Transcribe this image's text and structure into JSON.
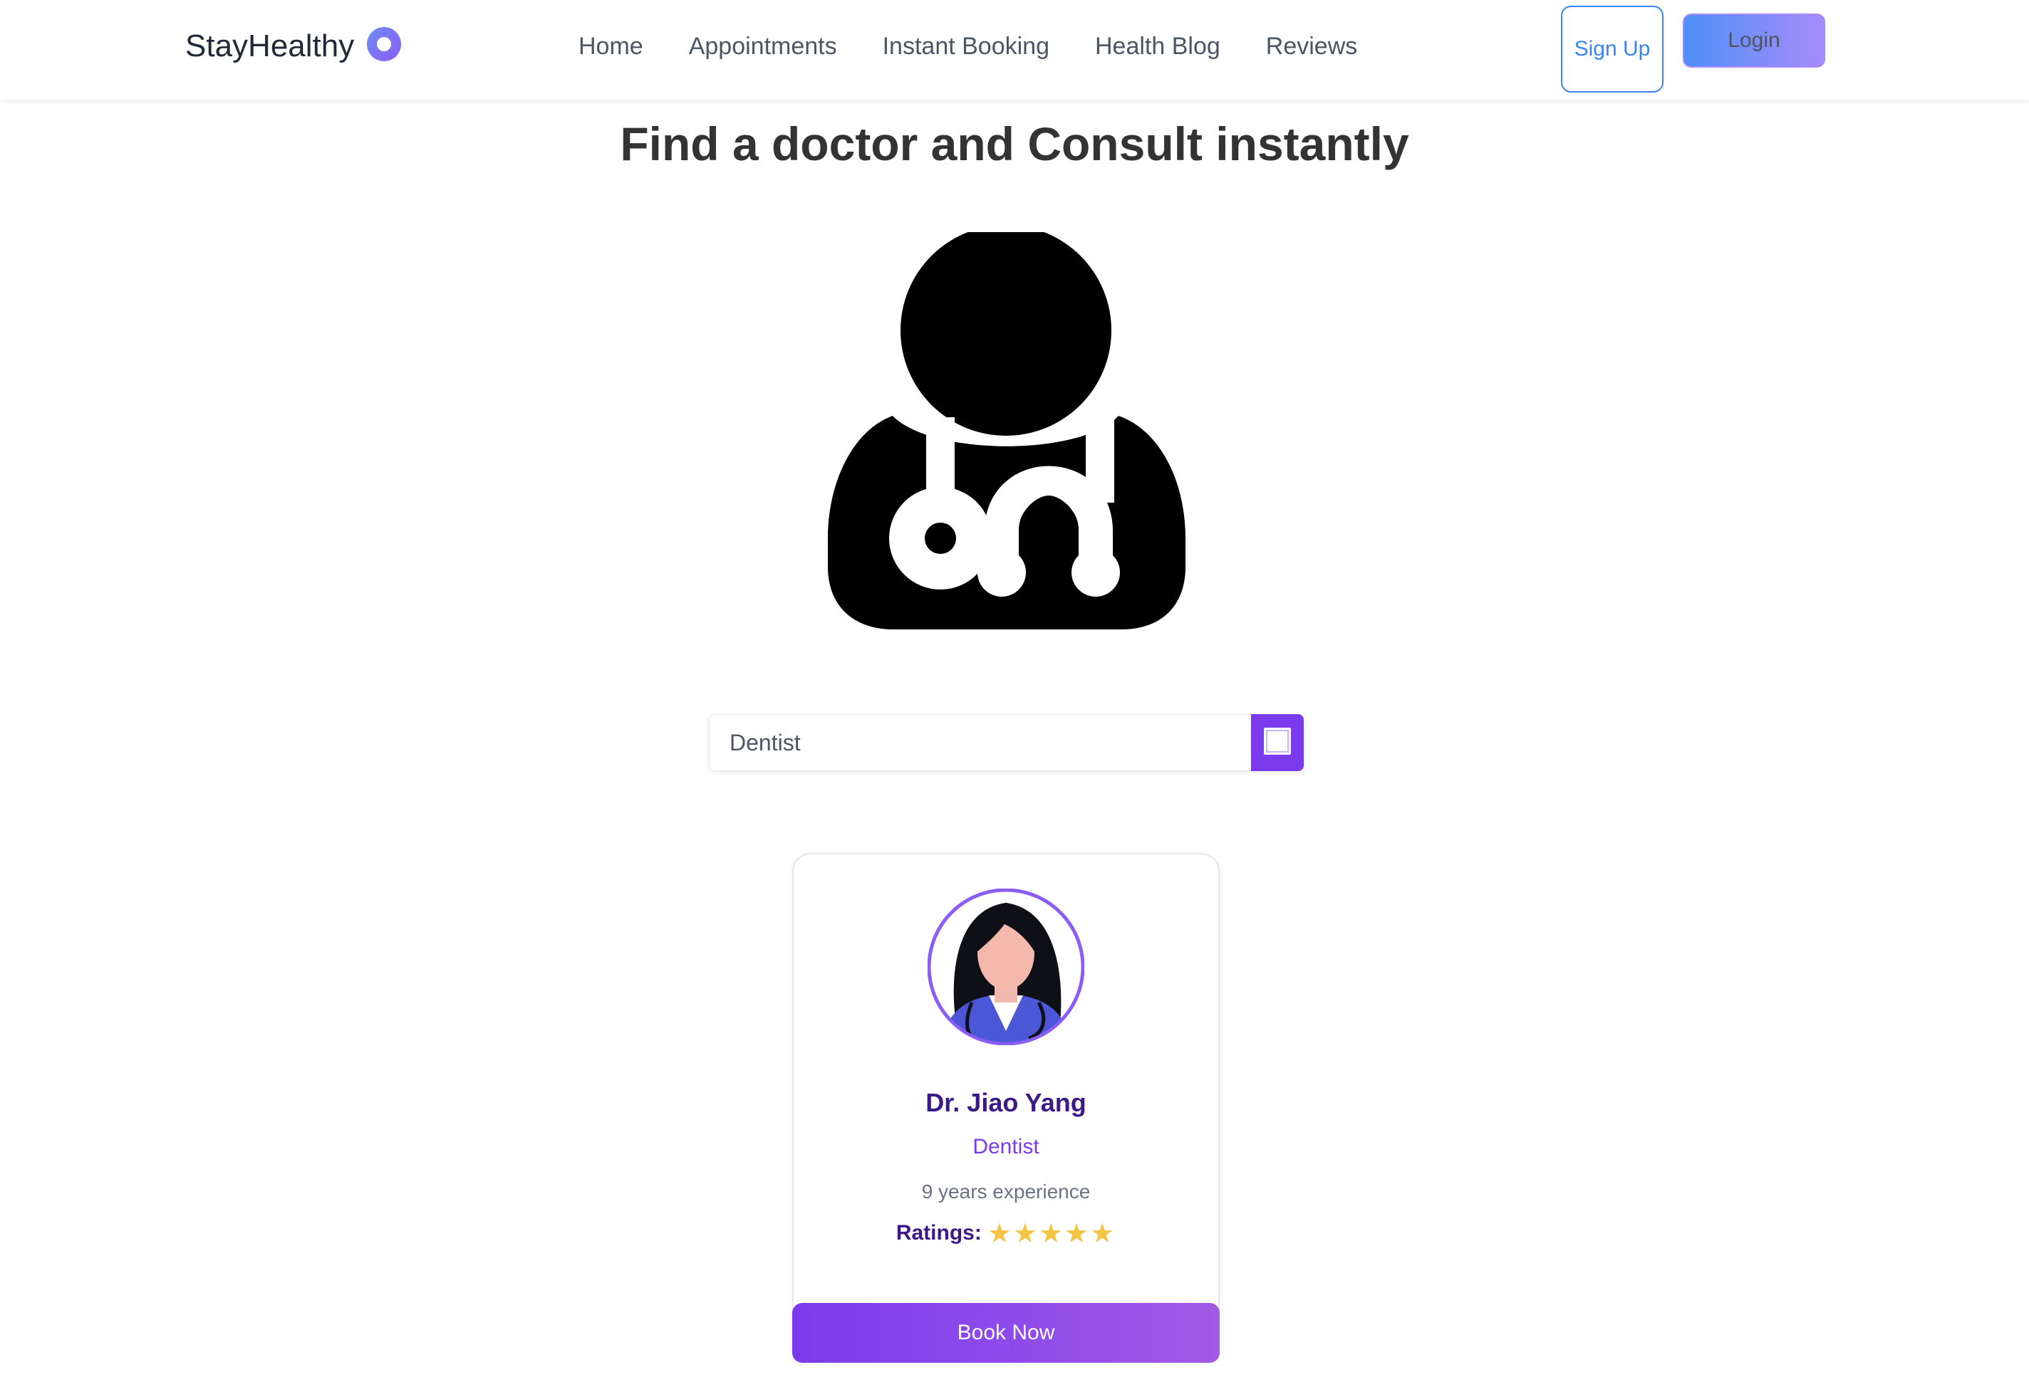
{
  "navbar": {
    "brand": "StayHealthy",
    "links": [
      "Home",
      "Appointments",
      "Instant Booking",
      "Health Blog",
      "Reviews"
    ],
    "signup_label": "Sign Up",
    "login_label": "Login"
  },
  "hero": {
    "title": "Find a doctor and Consult instantly"
  },
  "search": {
    "value": "Dentist"
  },
  "doctor_card": {
    "name": "Dr. Jiao Yang",
    "specialty": "Dentist",
    "experience": "9 years experience",
    "ratings_label": "Ratings:",
    "ratings_stars": "★★★★★",
    "rating": 5,
    "book_label": "Book Now"
  },
  "colors": {
    "accent": "#7c3aed",
    "link_blue": "#3b82f6",
    "star": "#f4c542",
    "name": "#3b1a88"
  },
  "icons": [
    "brand-ring-icon",
    "doctor-stethoscope-icon",
    "search-square-icon",
    "doctor-avatar-icon"
  ]
}
